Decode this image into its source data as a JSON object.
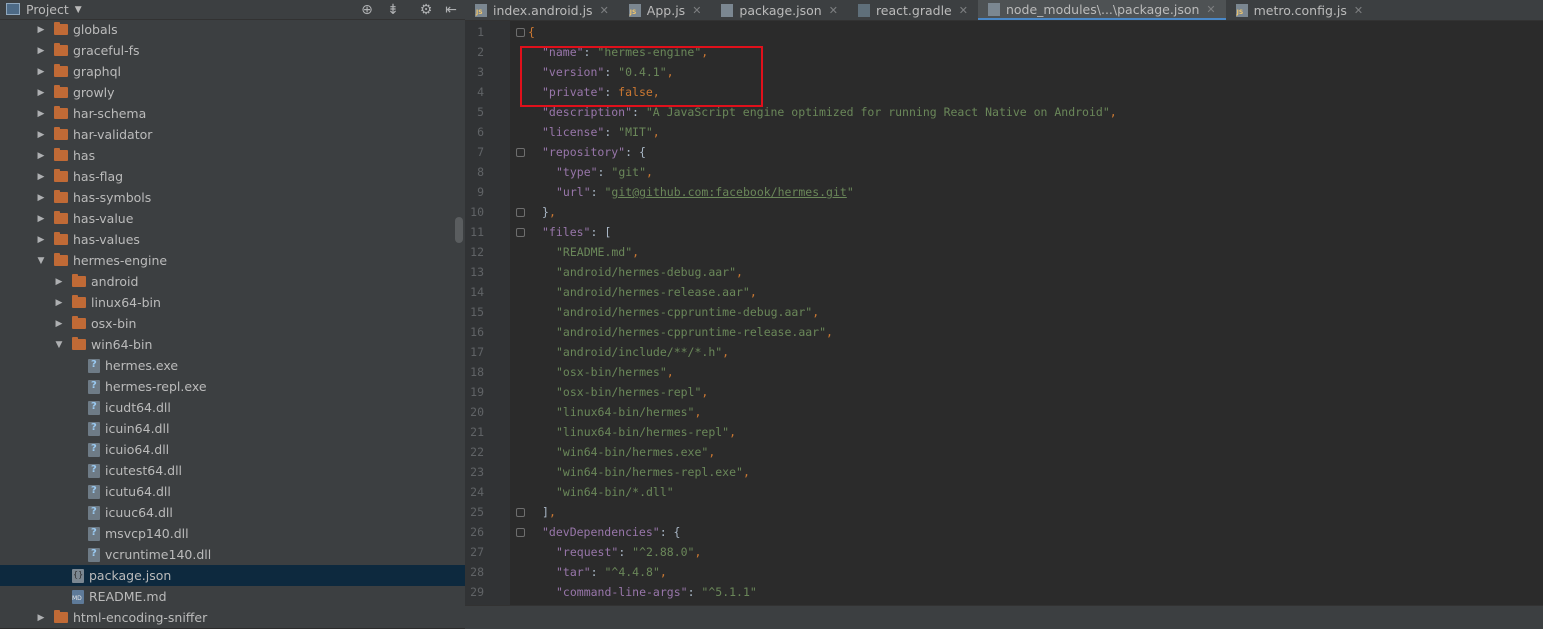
{
  "project_panel": {
    "title": "Project",
    "tree": [
      {
        "label": "globals",
        "kind": "folder",
        "depth": 0,
        "expanded": false
      },
      {
        "label": "graceful-fs",
        "kind": "folder",
        "depth": 0,
        "expanded": false
      },
      {
        "label": "graphql",
        "kind": "folder",
        "depth": 0,
        "expanded": false
      },
      {
        "label": "growly",
        "kind": "folder",
        "depth": 0,
        "expanded": false
      },
      {
        "label": "har-schema",
        "kind": "folder",
        "depth": 0,
        "expanded": false
      },
      {
        "label": "har-validator",
        "kind": "folder",
        "depth": 0,
        "expanded": false
      },
      {
        "label": "has",
        "kind": "folder",
        "depth": 0,
        "expanded": false
      },
      {
        "label": "has-flag",
        "kind": "folder",
        "depth": 0,
        "expanded": false
      },
      {
        "label": "has-symbols",
        "kind": "folder",
        "depth": 0,
        "expanded": false
      },
      {
        "label": "has-value",
        "kind": "folder",
        "depth": 0,
        "expanded": false
      },
      {
        "label": "has-values",
        "kind": "folder",
        "depth": 0,
        "expanded": false
      },
      {
        "label": "hermes-engine",
        "kind": "folder",
        "depth": 0,
        "expanded": true
      },
      {
        "label": "android",
        "kind": "folder",
        "depth": 1,
        "expanded": false
      },
      {
        "label": "linux64-bin",
        "kind": "folder",
        "depth": 1,
        "expanded": false
      },
      {
        "label": "osx-bin",
        "kind": "folder",
        "depth": 1,
        "expanded": false
      },
      {
        "label": "win64-bin",
        "kind": "folder",
        "depth": 1,
        "expanded": true
      },
      {
        "label": "hermes.exe",
        "kind": "exe",
        "depth": 2
      },
      {
        "label": "hermes-repl.exe",
        "kind": "exe",
        "depth": 2
      },
      {
        "label": "icudt64.dll",
        "kind": "exe",
        "depth": 2
      },
      {
        "label": "icuin64.dll",
        "kind": "exe",
        "depth": 2
      },
      {
        "label": "icuio64.dll",
        "kind": "exe",
        "depth": 2
      },
      {
        "label": "icutest64.dll",
        "kind": "exe",
        "depth": 2
      },
      {
        "label": "icutu64.dll",
        "kind": "exe",
        "depth": 2
      },
      {
        "label": "icuuc64.dll",
        "kind": "exe",
        "depth": 2
      },
      {
        "label": "msvcp140.dll",
        "kind": "exe",
        "depth": 2
      },
      {
        "label": "vcruntime140.dll",
        "kind": "exe",
        "depth": 2
      },
      {
        "label": "package.json",
        "kind": "json",
        "depth": 1,
        "selected": true
      },
      {
        "label": "README.md",
        "kind": "md",
        "depth": 1
      },
      {
        "label": "html-encoding-sniffer",
        "kind": "folder",
        "depth": 0,
        "expanded": false
      }
    ]
  },
  "tabs": [
    {
      "label": "index.android.js",
      "icon": "js-file-icon",
      "active": false
    },
    {
      "label": "App.js",
      "icon": "js-file-icon",
      "active": false
    },
    {
      "label": "package.json",
      "icon": "json-file-icon",
      "active": false
    },
    {
      "label": "react.gradle",
      "icon": "gradle-file-icon",
      "active": false
    },
    {
      "label": "node_modules\\...\\package.json",
      "icon": "json-file-icon",
      "active": true
    },
    {
      "label": "metro.config.js",
      "icon": "js-file-icon",
      "active": false
    }
  ],
  "editor": {
    "lines": [
      {
        "n": "1",
        "indent": 0,
        "tokens": [
          [
            "p",
            "{"
          ]
        ],
        "fold": true
      },
      {
        "n": "2",
        "indent": 1,
        "tokens": [
          [
            "k",
            "\"name\""
          ],
          [
            "t",
            ": "
          ],
          [
            "s",
            "\"hermes-engine\""
          ],
          [
            "p",
            ","
          ]
        ]
      },
      {
        "n": "3",
        "indent": 1,
        "tokens": [
          [
            "k",
            "\"version\""
          ],
          [
            "t",
            ": "
          ],
          [
            "s",
            "\"0.4.1\""
          ],
          [
            "p",
            ","
          ]
        ]
      },
      {
        "n": "4",
        "indent": 1,
        "tokens": [
          [
            "k",
            "\"private\""
          ],
          [
            "t",
            ": "
          ],
          [
            "w",
            "false"
          ],
          [
            "p",
            ","
          ]
        ]
      },
      {
        "n": "5",
        "indent": 1,
        "tokens": [
          [
            "k",
            "\"description\""
          ],
          [
            "t",
            ": "
          ],
          [
            "s",
            "\"A JavaScript engine optimized for running React Native on Android\""
          ],
          [
            "p",
            ","
          ]
        ]
      },
      {
        "n": "6",
        "indent": 1,
        "tokens": [
          [
            "k",
            "\"license\""
          ],
          [
            "t",
            ": "
          ],
          [
            "s",
            "\"MIT\""
          ],
          [
            "p",
            ","
          ]
        ]
      },
      {
        "n": "7",
        "indent": 1,
        "tokens": [
          [
            "k",
            "\"repository\""
          ],
          [
            "t",
            ": {"
          ]
        ],
        "fold": true
      },
      {
        "n": "8",
        "indent": 2,
        "tokens": [
          [
            "k",
            "\"type\""
          ],
          [
            "t",
            ": "
          ],
          [
            "s",
            "\"git\""
          ],
          [
            "p",
            ","
          ]
        ]
      },
      {
        "n": "9",
        "indent": 2,
        "tokens": [
          [
            "k",
            "\"url\""
          ],
          [
            "t",
            ": "
          ],
          [
            "s",
            "\""
          ],
          [
            "l",
            "git@github.com:facebook/hermes.git"
          ],
          [
            "s",
            "\""
          ]
        ]
      },
      {
        "n": "10",
        "indent": 1,
        "tokens": [
          [
            "t",
            "}"
          ],
          [
            "p",
            ","
          ]
        ],
        "fold": true
      },
      {
        "n": "11",
        "indent": 1,
        "tokens": [
          [
            "k",
            "\"files\""
          ],
          [
            "t",
            ": ["
          ]
        ],
        "fold": true
      },
      {
        "n": "12",
        "indent": 2,
        "tokens": [
          [
            "s",
            "\"README.md\""
          ],
          [
            "p",
            ","
          ]
        ]
      },
      {
        "n": "13",
        "indent": 2,
        "tokens": [
          [
            "s",
            "\"android/hermes-debug.aar\""
          ],
          [
            "p",
            ","
          ]
        ]
      },
      {
        "n": "14",
        "indent": 2,
        "tokens": [
          [
            "s",
            "\"android/hermes-release.aar\""
          ],
          [
            "p",
            ","
          ]
        ]
      },
      {
        "n": "15",
        "indent": 2,
        "tokens": [
          [
            "s",
            "\"android/hermes-cppruntime-debug.aar\""
          ],
          [
            "p",
            ","
          ]
        ]
      },
      {
        "n": "16",
        "indent": 2,
        "tokens": [
          [
            "s",
            "\"android/hermes-cppruntime-release.aar\""
          ],
          [
            "p",
            ","
          ]
        ]
      },
      {
        "n": "17",
        "indent": 2,
        "tokens": [
          [
            "s",
            "\"android/include/**/*.h\""
          ],
          [
            "p",
            ","
          ]
        ]
      },
      {
        "n": "18",
        "indent": 2,
        "tokens": [
          [
            "s",
            "\"osx-bin/hermes\""
          ],
          [
            "p",
            ","
          ]
        ]
      },
      {
        "n": "19",
        "indent": 2,
        "tokens": [
          [
            "s",
            "\"osx-bin/hermes-repl\""
          ],
          [
            "p",
            ","
          ]
        ]
      },
      {
        "n": "20",
        "indent": 2,
        "tokens": [
          [
            "s",
            "\"linux64-bin/hermes\""
          ],
          [
            "p",
            ","
          ]
        ]
      },
      {
        "n": "21",
        "indent": 2,
        "tokens": [
          [
            "s",
            "\"linux64-bin/hermes-repl\""
          ],
          [
            "p",
            ","
          ]
        ]
      },
      {
        "n": "22",
        "indent": 2,
        "tokens": [
          [
            "s",
            "\"win64-bin/hermes.exe\""
          ],
          [
            "p",
            ","
          ]
        ]
      },
      {
        "n": "23",
        "indent": 2,
        "tokens": [
          [
            "s",
            "\"win64-bin/hermes-repl.exe\""
          ],
          [
            "p",
            ","
          ]
        ]
      },
      {
        "n": "24",
        "indent": 2,
        "tokens": [
          [
            "s",
            "\"win64-bin/*.dll\""
          ]
        ]
      },
      {
        "n": "25",
        "indent": 1,
        "tokens": [
          [
            "t",
            "]"
          ],
          [
            "p",
            ","
          ]
        ],
        "fold": true
      },
      {
        "n": "26",
        "indent": 1,
        "tokens": [
          [
            "k",
            "\"devDependencies\""
          ],
          [
            "t",
            ": {"
          ]
        ],
        "fold": true
      },
      {
        "n": "27",
        "indent": 2,
        "tokens": [
          [
            "k",
            "\"request\""
          ],
          [
            "t",
            ": "
          ],
          [
            "s",
            "\"^2.88.0\""
          ],
          [
            "p",
            ","
          ]
        ]
      },
      {
        "n": "28",
        "indent": 2,
        "tokens": [
          [
            "k",
            "\"tar\""
          ],
          [
            "t",
            ": "
          ],
          [
            "s",
            "\"^4.4.8\""
          ],
          [
            "p",
            ","
          ]
        ]
      },
      {
        "n": "29",
        "indent": 2,
        "tokens": [
          [
            "k",
            "\"command-line-args\""
          ],
          [
            "t",
            ": "
          ],
          [
            "s",
            "\"^5.1.1\""
          ]
        ]
      }
    ]
  },
  "colors": {
    "key": "#9876aa",
    "string": "#6a8759",
    "keyword": "#cc7832",
    "highlight_box": "#e0101b"
  }
}
